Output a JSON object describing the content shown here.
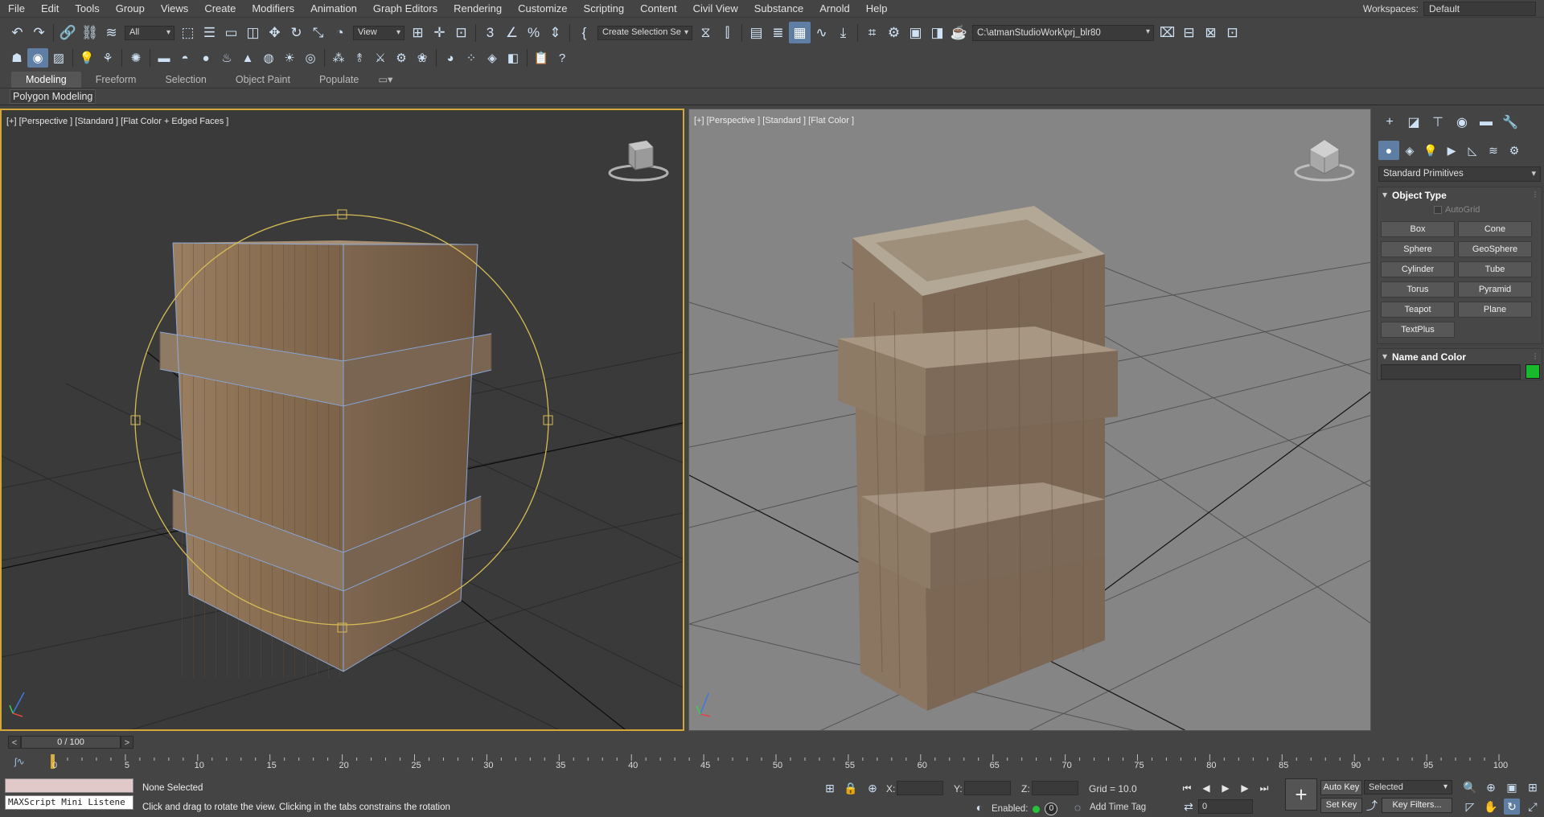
{
  "menu": [
    "File",
    "Edit",
    "Tools",
    "Group",
    "Views",
    "Create",
    "Modifiers",
    "Animation",
    "Graph Editors",
    "Rendering",
    "Customize",
    "Scripting",
    "Content",
    "Civil View",
    "Substance",
    "Arnold",
    "Help"
  ],
  "workspace": {
    "label": "Workspaces:",
    "value": "Default"
  },
  "toolbar": {
    "selection_filter": "All",
    "ref_coord": "View",
    "named_selection": "Create Selection Se",
    "project_path": "C:\\atmanStudioWork\\prj_blr80"
  },
  "ribbon": {
    "tabs": [
      "Modeling",
      "Freeform",
      "Selection",
      "Object Paint",
      "Populate"
    ],
    "active_tab": "Modeling",
    "panel": "Polygon Modeling"
  },
  "viewport_left": {
    "label": "[+] [Perspective ] [Standard ] [Flat Color + Edged Faces ]"
  },
  "viewport_right": {
    "label": "[+] [Perspective ] [Standard ] [Flat Color ]"
  },
  "command_panel": {
    "category": "Standard Primitives",
    "object_type": {
      "title": "Object Type",
      "autogrid": "AutoGrid",
      "buttons": [
        "Box",
        "Cone",
        "Sphere",
        "GeoSphere",
        "Cylinder",
        "Tube",
        "Torus",
        "Pyramid",
        "Teapot",
        "Plane",
        "TextPlus"
      ]
    },
    "name_color": {
      "title": "Name and Color",
      "color": "#19b92e"
    }
  },
  "time_slider": {
    "value": "0 / 100",
    "prev": "<",
    "next": ">"
  },
  "trackbar": {
    "ticks": [
      "0",
      "5",
      "10",
      "15",
      "20",
      "25",
      "30",
      "35",
      "40",
      "45",
      "50",
      "55",
      "60",
      "65",
      "70",
      "75",
      "80",
      "85",
      "90",
      "95",
      "100"
    ]
  },
  "status": {
    "maxscript": "MAXScript Mini Listene",
    "selection": "None Selected",
    "prompt": "Click and drag to rotate the view.  Clicking in the tabs constrains the rotation",
    "x_label": "X:",
    "y_label": "Y:",
    "z_label": "Z:",
    "grid": "Grid = 10.0",
    "enabled": "Enabled:",
    "enabled_count": "0",
    "add_time_tag": "Add Time Tag",
    "auto_key": "Auto Key",
    "set_key": "Set Key",
    "key_mode": "Selected",
    "key_filters": "Key Filters...",
    "frame": "0"
  }
}
